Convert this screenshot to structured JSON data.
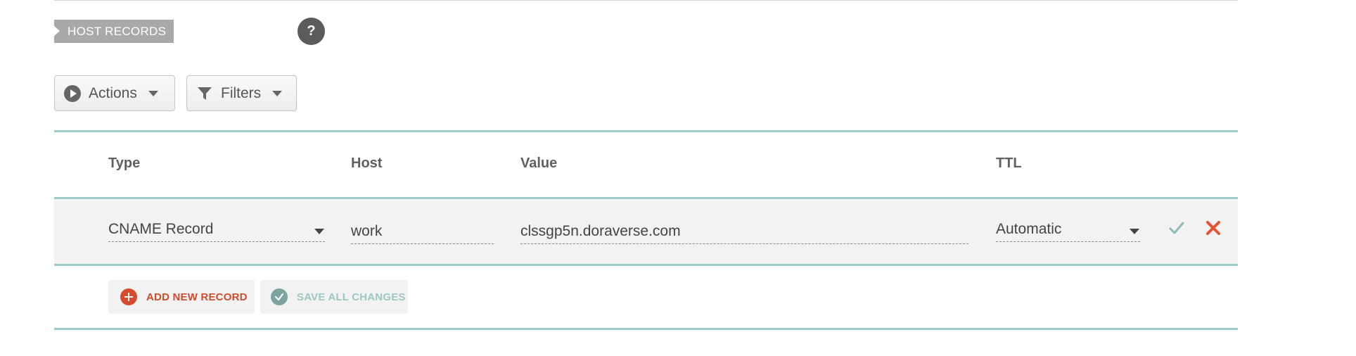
{
  "section": {
    "title": "HOST RECORDS",
    "help_glyph": "?"
  },
  "toolbar": {
    "actions_label": "Actions",
    "actions_icon": "play-circle-icon",
    "filters_label": "Filters",
    "filters_icon": "funnel-icon"
  },
  "table": {
    "columns": {
      "type": "Type",
      "host": "Host",
      "value": "Value",
      "ttl": "TTL"
    },
    "rows": [
      {
        "type": "CNAME Record",
        "host": "work",
        "value": "clssgp5n.doraverse.com",
        "ttl": "Automatic"
      }
    ]
  },
  "footer": {
    "add_label": "ADD NEW RECORD",
    "save_label": "SAVE ALL CHANGES"
  },
  "colors": {
    "accent_teal": "#9ccbc9",
    "danger_red": "#e5532f",
    "confirm_teal": "#8bbcb8",
    "tag_gray": "#a9a9a9"
  }
}
